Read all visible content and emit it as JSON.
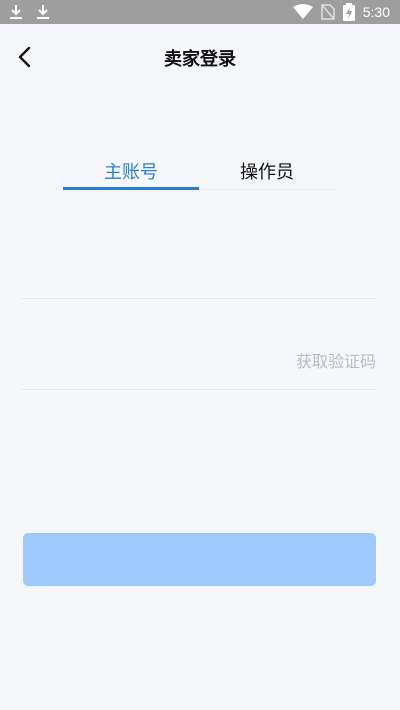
{
  "status_bar": {
    "time": "5:30",
    "icons": [
      "download-icon",
      "download-icon",
      "wifi-icon",
      "no-sim-icon",
      "battery-charging-icon"
    ]
  },
  "header": {
    "title": "卖家登录",
    "back_icon": "chevron-left-icon"
  },
  "tabs": [
    {
      "label": "主账号",
      "active": true
    },
    {
      "label": "操作员",
      "active": false
    }
  ],
  "form": {
    "account": {
      "value": "",
      "placeholder": ""
    },
    "code": {
      "value": "",
      "placeholder": ""
    },
    "get_code_label": "获取验证码",
    "login_button_label": ""
  },
  "colors": {
    "accent": "#2a7fd4",
    "button_disabled": "#9ec9fb",
    "background": "#f5f7fb",
    "status_bar": "#9e9e9e"
  }
}
